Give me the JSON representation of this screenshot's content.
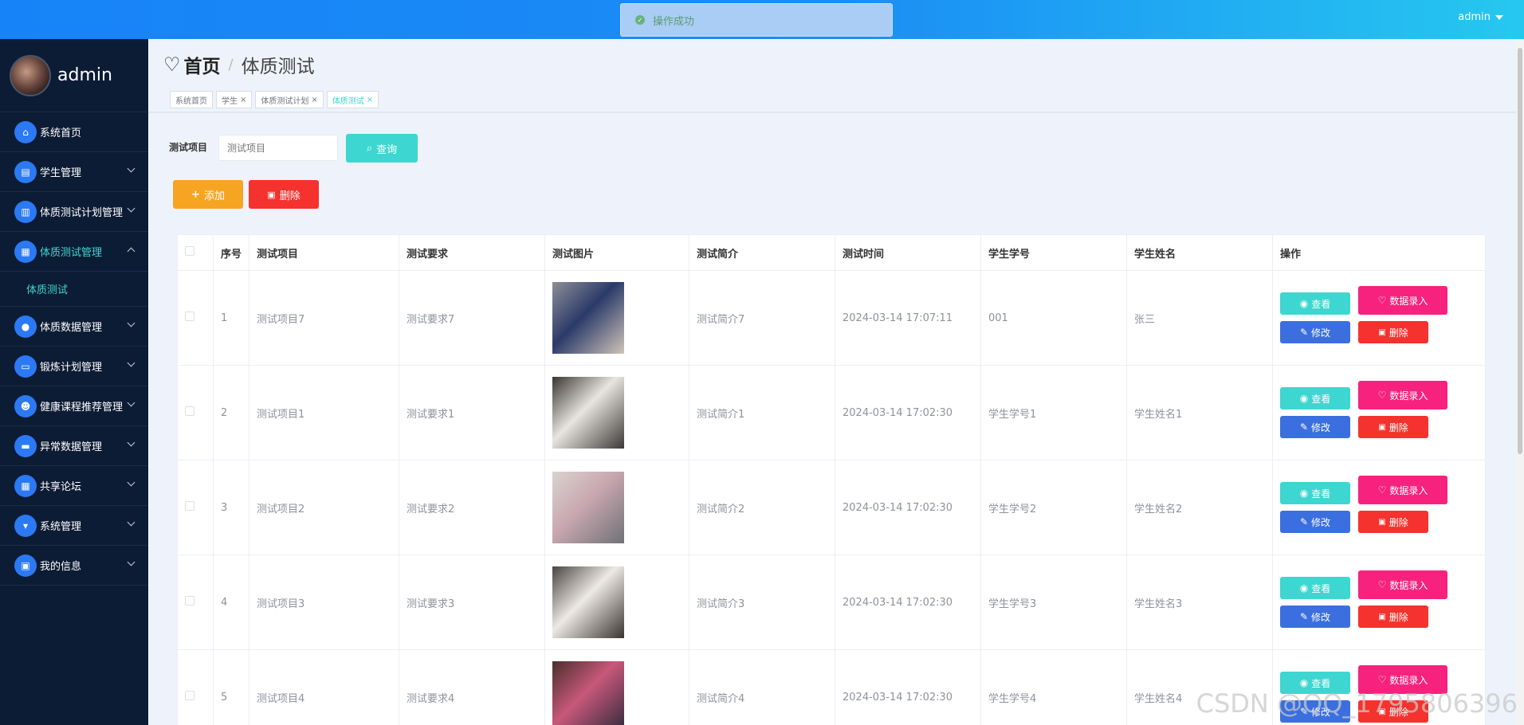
{
  "topbar": {
    "toast": "操作成功",
    "user": "admin"
  },
  "sidebar": {
    "username": "admin",
    "items": [
      {
        "label": "系统首页",
        "icon": "home-icon"
      },
      {
        "label": "学生管理",
        "icon": "book-icon"
      },
      {
        "label": "体质测试计划管理",
        "icon": "clipboard-icon"
      },
      {
        "label": "体质测试管理",
        "icon": "grid-icon",
        "active": true
      },
      {
        "label": "体质数据管理",
        "icon": "pin-icon"
      },
      {
        "label": "锻炼计划管理",
        "icon": "monitor-icon"
      },
      {
        "label": "健康课程推荐管理",
        "icon": "user-icon"
      },
      {
        "label": "异常数据管理",
        "icon": "screen-icon"
      },
      {
        "label": "共享论坛",
        "icon": "apps-icon"
      },
      {
        "label": "系统管理",
        "icon": "settings-icon"
      },
      {
        "label": "我的信息",
        "icon": "card-icon"
      }
    ],
    "sub_item": "体质测试"
  },
  "header": {
    "home": "首页",
    "current": "体质测试",
    "tabs": [
      {
        "label": "系统首页",
        "closable": false
      },
      {
        "label": "学生",
        "closable": true
      },
      {
        "label": "体质测试计划",
        "closable": true
      },
      {
        "label": "体质测试",
        "closable": true,
        "active": true
      }
    ]
  },
  "search": {
    "label": "测试项目",
    "placeholder": "测试项目",
    "button": "查询"
  },
  "actions": {
    "add": "添加",
    "delete": "删除"
  },
  "table": {
    "headers": [
      "序号",
      "测试项目",
      "测试要求",
      "测试图片",
      "测试简介",
      "测试时间",
      "学生学号",
      "学生姓名",
      "操作"
    ],
    "rows": [
      [
        "1",
        "测试项目7",
        "测试要求7",
        "测试简介7",
        "2024-03-14 17:07:11",
        "001",
        "张三"
      ],
      [
        "2",
        "测试项目1",
        "测试要求1",
        "测试简介1",
        "2024-03-14 17:02:30",
        "学生学号1",
        "学生姓名1"
      ],
      [
        "3",
        "测试项目2",
        "测试要求2",
        "测试简介2",
        "2024-03-14 17:02:30",
        "学生学号2",
        "学生姓名2"
      ],
      [
        "4",
        "测试项目3",
        "测试要求3",
        "测试简介3",
        "2024-03-14 17:02:30",
        "学生学号3",
        "学生姓名3"
      ],
      [
        "5",
        "测试项目4",
        "测试要求4",
        "测试简介4",
        "2024-03-14 17:02:30",
        "学生学号4",
        "学生姓名4"
      ]
    ],
    "ops": {
      "view": "查看",
      "data": "数据录入",
      "edit": "修改",
      "delete": "删除"
    }
  },
  "watermark": "CSDN @QQ_1795806396"
}
